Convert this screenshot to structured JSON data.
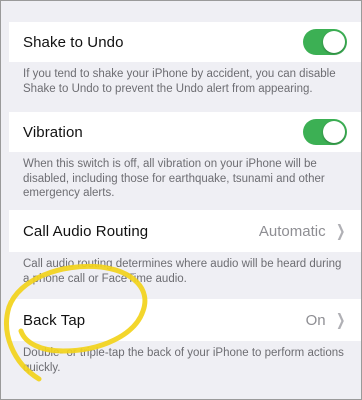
{
  "settings": {
    "shake": {
      "label": "Shake to Undo",
      "toggle_on": true,
      "note": "If you tend to shake your iPhone by accident, you can disable Shake to Undo to prevent the Undo alert from appearing."
    },
    "vibration": {
      "label": "Vibration",
      "toggle_on": true,
      "note": "When this switch is off, all vibration on your iPhone will be disabled, including those for earthquake, tsunami and other emergency alerts."
    },
    "call_audio": {
      "label": "Call Audio Routing",
      "value": "Automatic",
      "note": "Call audio routing determines where audio will be heard during a phone call or FaceTime audio."
    },
    "back_tap": {
      "label": "Back Tap",
      "value": "On",
      "note": "Double- or triple-tap the back of your iPhone to perform actions quickly."
    }
  },
  "colors": {
    "toggle_on": "#3cb054",
    "annotation": "#f2d21a"
  },
  "icons": {
    "chevron": "chevron-right-icon"
  }
}
